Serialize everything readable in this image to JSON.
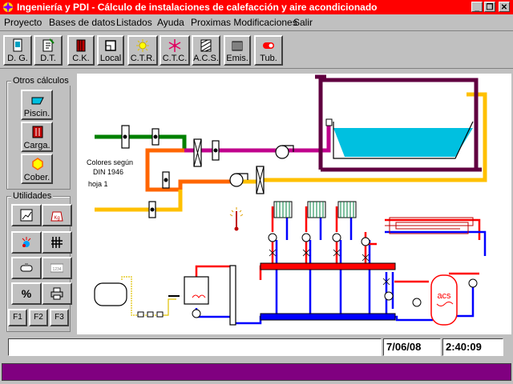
{
  "window": {
    "title": "Ingeniería y PDI  - Cálculo de instalaciones de calefacción y aire acondicionado",
    "minimize": "_",
    "restore": "❐",
    "close": "✕"
  },
  "menu": [
    "Proyecto",
    "Bases de datos",
    "Listados",
    "Ayuda",
    "Proximas Modificaciones",
    "Salir"
  ],
  "toolbar": [
    {
      "label": "D. G.",
      "icon": "document-icon"
    },
    {
      "label": "D.T.",
      "icon": "edit-document-icon"
    },
    {
      "label": "C.K.",
      "icon": "radiator-icon"
    },
    {
      "label": "Local",
      "icon": "room-icon"
    },
    {
      "label": "C.T.R.",
      "icon": "sun-icon"
    },
    {
      "label": "C.T.C.",
      "icon": "snowflake-icon"
    },
    {
      "label": "A.C.S.",
      "icon": "hatch-icon"
    },
    {
      "label": "Emis.",
      "icon": "emitter-icon"
    },
    {
      "label": "Tub.",
      "icon": "pipe-icon"
    }
  ],
  "sidebar": {
    "otros_title": "Otros cálculos",
    "otros": [
      {
        "label": "Piscin.",
        "icon": "pool-icon"
      },
      {
        "label": "Carga.",
        "icon": "heater-icon"
      },
      {
        "label": "Cober.",
        "icon": "cover-icon"
      }
    ],
    "utilidades_title": "Utilidades",
    "utilidades": [
      {
        "icon": "graph-icon"
      },
      {
        "icon": "weight-icon",
        "text": "Kg"
      },
      {
        "icon": "thermometer-icon"
      },
      {
        "icon": "hydraulic-icon"
      },
      {
        "icon": "tank-icon"
      },
      {
        "icon": "counter-icon",
        "text": "1234"
      },
      {
        "icon": "percent-icon",
        "text": "%"
      },
      {
        "icon": "printer-icon"
      }
    ],
    "fkeys": [
      "F1",
      "F2",
      "F3"
    ]
  },
  "diagram": {
    "note_lines": [
      "Colores según",
      "DIN 1946",
      "hoja 1"
    ],
    "tank_label": "acs"
  },
  "status": {
    "message": "",
    "date": "7/06/08",
    "time": "2:40:09"
  },
  "colors": {
    "titlebar": "#ff0000",
    "footer": "#800080",
    "green_pipe": "#008000",
    "orange_pipe": "#ff6600",
    "yellow_pipe": "#ffc000",
    "magenta_pipe": "#c0008c",
    "supply": "#ff0000",
    "return": "#0000ff",
    "duct": "#600040",
    "water": "#00c0e0"
  }
}
